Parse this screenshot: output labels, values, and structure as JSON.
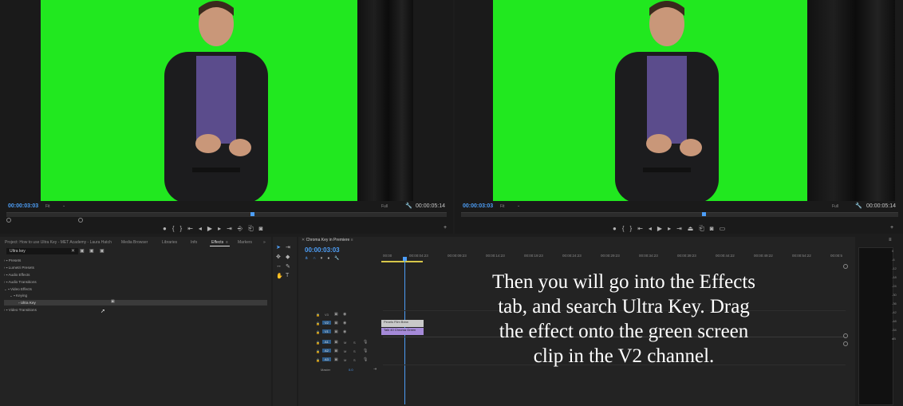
{
  "source_monitor": {
    "timecode": "00:00:03:03",
    "fit": "Fit",
    "full": "Full",
    "duration": "00:00:05:14"
  },
  "program_monitor": {
    "timecode": "00:00:03:03",
    "fit": "Fit",
    "full": "Full",
    "duration": "00:00:05:14"
  },
  "project_panel": {
    "tabs": [
      "Project: How to use Ultra Key - MET Academy - Laura Hatch",
      "Media Browser",
      "Libraries",
      "Info",
      "Effects",
      "Markers"
    ],
    "search_value": "Ultra key",
    "tree": [
      {
        "label": "Presets",
        "level": 0
      },
      {
        "label": "Lumetri Presets",
        "level": 0
      },
      {
        "label": "Audio Effects",
        "level": 0
      },
      {
        "label": "Audio Transitions",
        "level": 0
      },
      {
        "label": "Video Effects",
        "level": 0
      },
      {
        "label": "Keying",
        "level": 1
      },
      {
        "label": "Ultra Key",
        "level": 2
      },
      {
        "label": "Video Transitions",
        "level": 0
      }
    ]
  },
  "timeline": {
    "sequence_name": "Chroma Key in Premiere",
    "timecode": "00:00:03:03",
    "ruler": [
      "00:00",
      "00:00:04:23",
      "00:00:09:23",
      "00:00:14:23",
      "00:00:19:23",
      "00:00:24:23",
      "00:00:29:23",
      "00:00:34:23",
      "00:00:39:23",
      "00:00:44:22",
      "00:00:49:22",
      "00:00:54:22",
      "00:00:5"
    ],
    "tracks": [
      "V3",
      "V2",
      "V1",
      "A1",
      "A2",
      "A3"
    ],
    "master_label": "Master",
    "master_value": "0.0",
    "clips": [
      {
        "track": "V2",
        "label": "Pexels Film Brew"
      },
      {
        "track": "V1",
        "label": "Talk 40 Chroma Green"
      }
    ]
  },
  "meter_scale": [
    "0",
    "-6",
    "-12",
    "-18",
    "-24",
    "-30",
    "-36",
    "-42",
    "-48",
    "-54",
    "dB"
  ],
  "caption": {
    "lines": [
      "Then you will go into the Effects",
      "tab, and search Ultra Key. Drag",
      "the effect onto the green screen",
      "clip in the V2 channel."
    ]
  },
  "colors": {
    "green_screen": "#21e81f",
    "timecode_blue": "#4d9ef7",
    "clip_v2": "#c9c9c9",
    "clip_v1": "#a58ad8"
  }
}
